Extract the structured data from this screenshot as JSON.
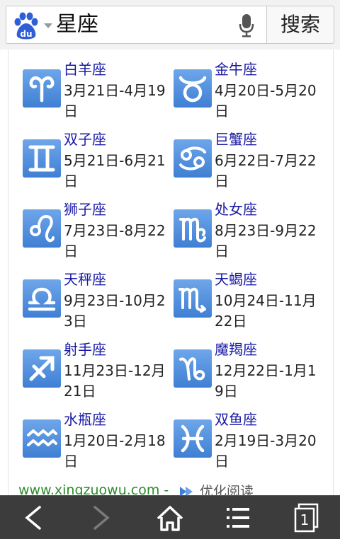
{
  "search": {
    "query": "星座",
    "button_label": "搜索"
  },
  "zodiac": [
    {
      "name": "白羊座",
      "dates": "3月21日-4月19日",
      "icon": "aries-icon"
    },
    {
      "name": "金牛座",
      "dates": "4月20日-5月20日",
      "icon": "taurus-icon"
    },
    {
      "name": "双子座",
      "dates": "5月21日-6月21日",
      "icon": "gemini-icon"
    },
    {
      "name": "巨蟹座",
      "dates": "6月22日-7月22日",
      "icon": "cancer-icon"
    },
    {
      "name": "狮子座",
      "dates": "7月23日-8月22日",
      "icon": "leo-icon"
    },
    {
      "name": "处女座",
      "dates": "8月23日-9月22日",
      "icon": "virgo-icon"
    },
    {
      "name": "天秤座",
      "dates": "9月23日-10月23日",
      "icon": "libra-icon"
    },
    {
      "name": "天蝎座",
      "dates": "10月24日-11月22日",
      "icon": "scorpio-icon"
    },
    {
      "name": "射手座",
      "dates": "11月23日-12月21日",
      "icon": "sagittarius-icon"
    },
    {
      "name": "魔羯座",
      "dates": "12月22日-1月19日",
      "icon": "capricorn-icon"
    },
    {
      "name": "水瓶座",
      "dates": "1月20日-2月18日",
      "icon": "aquarius-icon"
    },
    {
      "name": "双鱼座",
      "dates": "2月19日-3月20日",
      "icon": "pisces-icon"
    }
  ],
  "footer": {
    "source": "www.xingzuowu.com -",
    "reader_label": "优化阅读"
  },
  "bottom_nav": {
    "tab_count": "1"
  },
  "colors": {
    "link": "#1a1aa6",
    "icon_blue": "#3f7fd3",
    "source_green": "#2a8a2a"
  }
}
